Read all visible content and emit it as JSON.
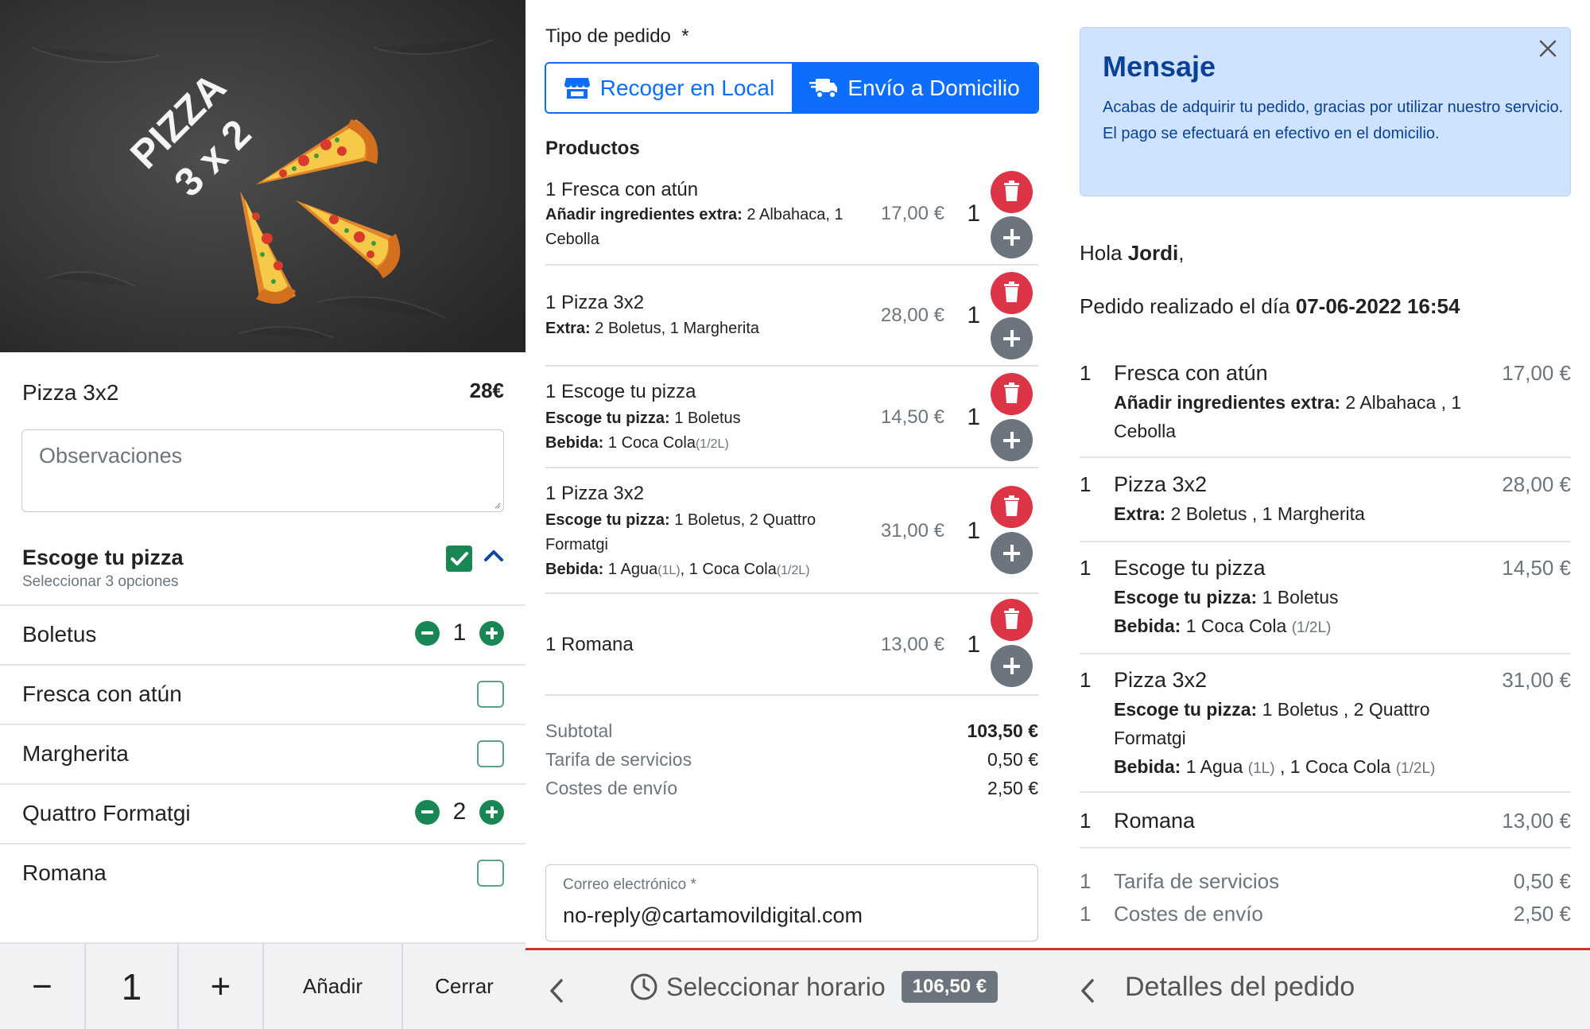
{
  "colors": {
    "primary": "#0d6efd",
    "success": "#198754",
    "danger": "#dc3545",
    "secondary": "#6c757d",
    "alert_bg": "#cfe2ff",
    "alert_text": "#084298",
    "accent_red_line": "#d32f2f"
  },
  "panel1": {
    "banner": {
      "line1": "PIZZA",
      "line2": "3 x 2"
    },
    "product": {
      "name": "Pizza 3x2",
      "price": "28€"
    },
    "observations_placeholder": "Observaciones",
    "group": {
      "title": "Escoge tu pizza",
      "subtitle": "Seleccionar 3 opciones",
      "checked": true
    },
    "options": [
      {
        "name": "Boletus",
        "qty": "1",
        "selected": true
      },
      {
        "name": "Fresca con atún",
        "selected": false
      },
      {
        "name": "Margherita",
        "selected": false
      },
      {
        "name": "Quattro Formatgi",
        "qty": "2",
        "selected": true
      },
      {
        "name": "Romana",
        "selected": false
      }
    ],
    "footer": {
      "minus": "−",
      "qty": "1",
      "plus": "+",
      "add": "Añadir",
      "close": "Cerrar"
    }
  },
  "panel2": {
    "order_type_label": "Tipo de pedido",
    "required_mark": "*",
    "order_types": [
      {
        "label": "Recoger en Local",
        "icon": "store-icon",
        "active": false
      },
      {
        "label": "Envío a Domicilio",
        "icon": "truck-icon",
        "active": true
      }
    ],
    "products_heading": "Productos",
    "items": [
      {
        "title": "1 Fresca con atún",
        "line1_label": "Añadir ingredientes extra:",
        "line1_value": " 2 Albahaca, 1 Cebolla",
        "price": "17,00 €",
        "qty": "1"
      },
      {
        "title": "1 Pizza 3x2",
        "line1_label": "Extra:",
        "line1_value": " 2 Boletus, 1 Margherita",
        "price": "28,00 €",
        "qty": "1"
      },
      {
        "title": "1 Escoge tu pizza",
        "line1_label": "Escoge tu pizza:",
        "line1_value": " 1 Boletus",
        "line2_label": "Bebida:",
        "line2_value": " 1 Coca Cola",
        "line2_small": "(1/2L)",
        "price": "14,50 €",
        "qty": "1"
      },
      {
        "title": "1 Pizza 3x2",
        "line1_label": "Escoge tu pizza:",
        "line1_value": " 1 Boletus, 2 Quattro Formatgi",
        "line2_label": "Bebida:",
        "line2_value1": " 1 Agua",
        "line2_small1": "(1L)",
        "line2_value2": ", 1 Coca Cola",
        "line2_small2": "(1/2L)",
        "price": "31,00 €",
        "qty": "1"
      },
      {
        "title": "1 Romana",
        "price": "13,00 €",
        "qty": "1"
      }
    ],
    "summary": [
      {
        "label": "Subtotal",
        "value": "103,50 €"
      },
      {
        "label": "Tarifa de servicios",
        "value": "0,50 €"
      },
      {
        "label": "Costes de envío",
        "value": "2,50 €"
      }
    ],
    "email": {
      "label": "Correo electrónico *",
      "value": "no-reply@cartamovildigital.com"
    },
    "footer": {
      "schedule_label": "Seleccionar horario",
      "total": "106,50 €"
    }
  },
  "panel3": {
    "alert": {
      "title": "Mensaje",
      "line1": "Acabas de adquirir tu pedido, gracias por utilizar nuestro servicio.",
      "line2": "El pago se efectuará en efectivo en el domicilio."
    },
    "greeting_prefix": "Hola ",
    "greeting_name": "Jordi",
    "greeting_suffix": ",",
    "order_date_prefix": "Pedido realizado el día ",
    "order_date": "07-06-2022 16:54",
    "items": [
      {
        "qty": "1",
        "title": "Fresca con atún",
        "price": "17,00 €",
        "d1_label": "Añadir ingredientes extra:",
        "d1_value": " 2 Albahaca , 1 Cebolla"
      },
      {
        "qty": "1",
        "title": "Pizza 3x2",
        "price": "28,00 €",
        "d1_label": "Extra:",
        "d1_value": " 2 Boletus , 1 Margherita"
      },
      {
        "qty": "1",
        "title": "Escoge tu pizza",
        "price": "14,50 €",
        "d1_label": "Escoge tu pizza:",
        "d1_value": " 1 Boletus",
        "d2_label": "Bebida:",
        "d2_value": " 1 Coca Cola ",
        "d2_small": "(1/2L)"
      },
      {
        "qty": "1",
        "title": "Pizza 3x2",
        "price": "31,00 €",
        "d1_label": "Escoge tu pizza:",
        "d1_value": " 1 Boletus , 2 Quattro Formatgi",
        "d2_label": "Bebida:",
        "d2_value1": " 1 Agua ",
        "d2_small1": "(1L)",
        "d2_value2": " , 1 Coca Cola ",
        "d2_small2": "(1/2L)"
      },
      {
        "qty": "1",
        "title": "Romana",
        "price": "13,00 €"
      }
    ],
    "fees": [
      {
        "qty": "1",
        "label": "Tarifa de servicios",
        "price": "0,50 €"
      },
      {
        "qty": "1",
        "label": "Costes de envío",
        "price": "2,50 €"
      }
    ],
    "footer_title": "Detalles del pedido"
  }
}
